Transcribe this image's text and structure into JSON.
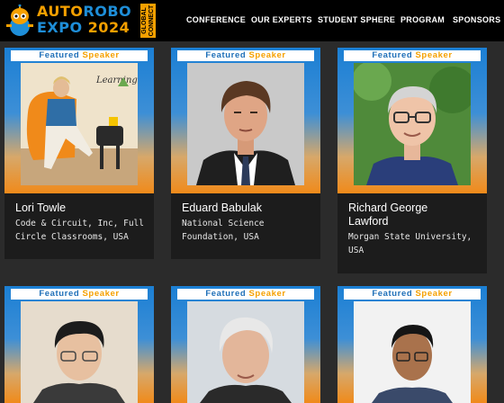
{
  "header": {
    "logo": {
      "line1_a": "AUTO",
      "line1_b": "ROBO",
      "line2_a": "EXPO",
      "line2_b": "2024",
      "badge": "GLOBAL\nCONNECT"
    },
    "nav": [
      "CONFERENCE",
      "OUR EXPERTS",
      "STUDENT SPHERE",
      "PROGRAM",
      "SPONSORS"
    ]
  },
  "featured": {
    "word1": "Featured",
    "word2": "Speaker"
  },
  "speakers": [
    {
      "name": "Lori Towle",
      "affiliation": [
        "Code & Circuit, Inc, Full",
        "Circle Classrooms, USA"
      ],
      "photo_text": "Learning Together"
    },
    {
      "name": "Eduard Babulak",
      "affiliation": [
        "National Science",
        "Foundation, USA"
      ]
    },
    {
      "name": [
        "Richard George",
        "Lawford"
      ],
      "affiliation": [
        "Morgan State University,",
        "USA"
      ]
    }
  ],
  "colors": {
    "accent_blue": "#1e8ed8",
    "accent_orange": "#f5a000",
    "background": "#2b2b2b",
    "header": "#000000"
  }
}
